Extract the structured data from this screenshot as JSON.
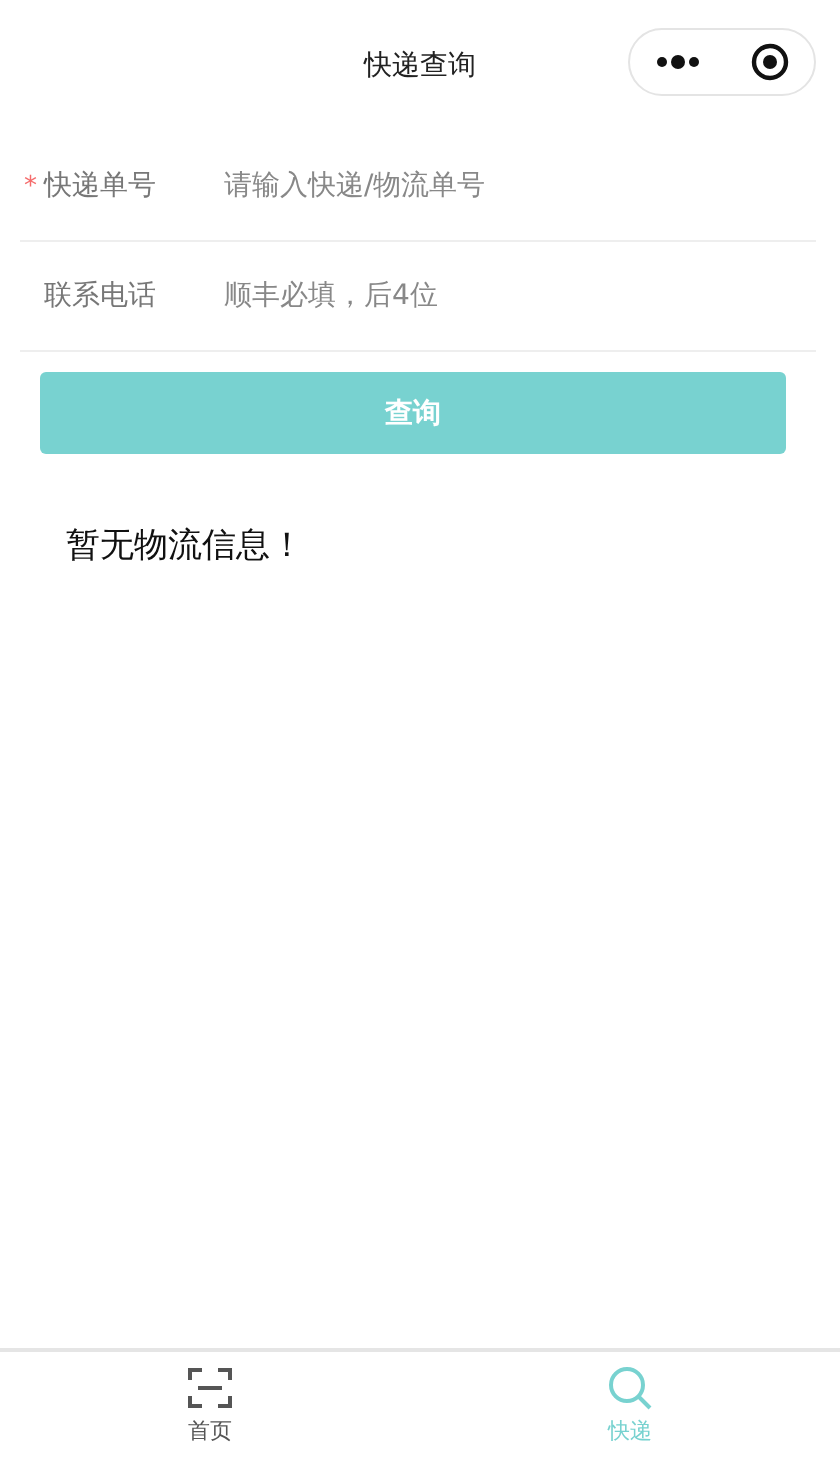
{
  "nav": {
    "title": "快递查询"
  },
  "form": {
    "fields": [
      {
        "label": "快递单号",
        "required": true,
        "placeholder": "请输入快递/物流单号"
      },
      {
        "label": "联系电话",
        "required": false,
        "placeholder": "顺丰必填，后4位"
      }
    ],
    "required_mark": "*",
    "submit": "查询"
  },
  "message": "暂无物流信息！",
  "tab_bar": [
    {
      "label": "首页",
      "kind": "scan",
      "selected": false
    },
    {
      "label": "快递",
      "kind": "search",
      "selected": true
    }
  ]
}
